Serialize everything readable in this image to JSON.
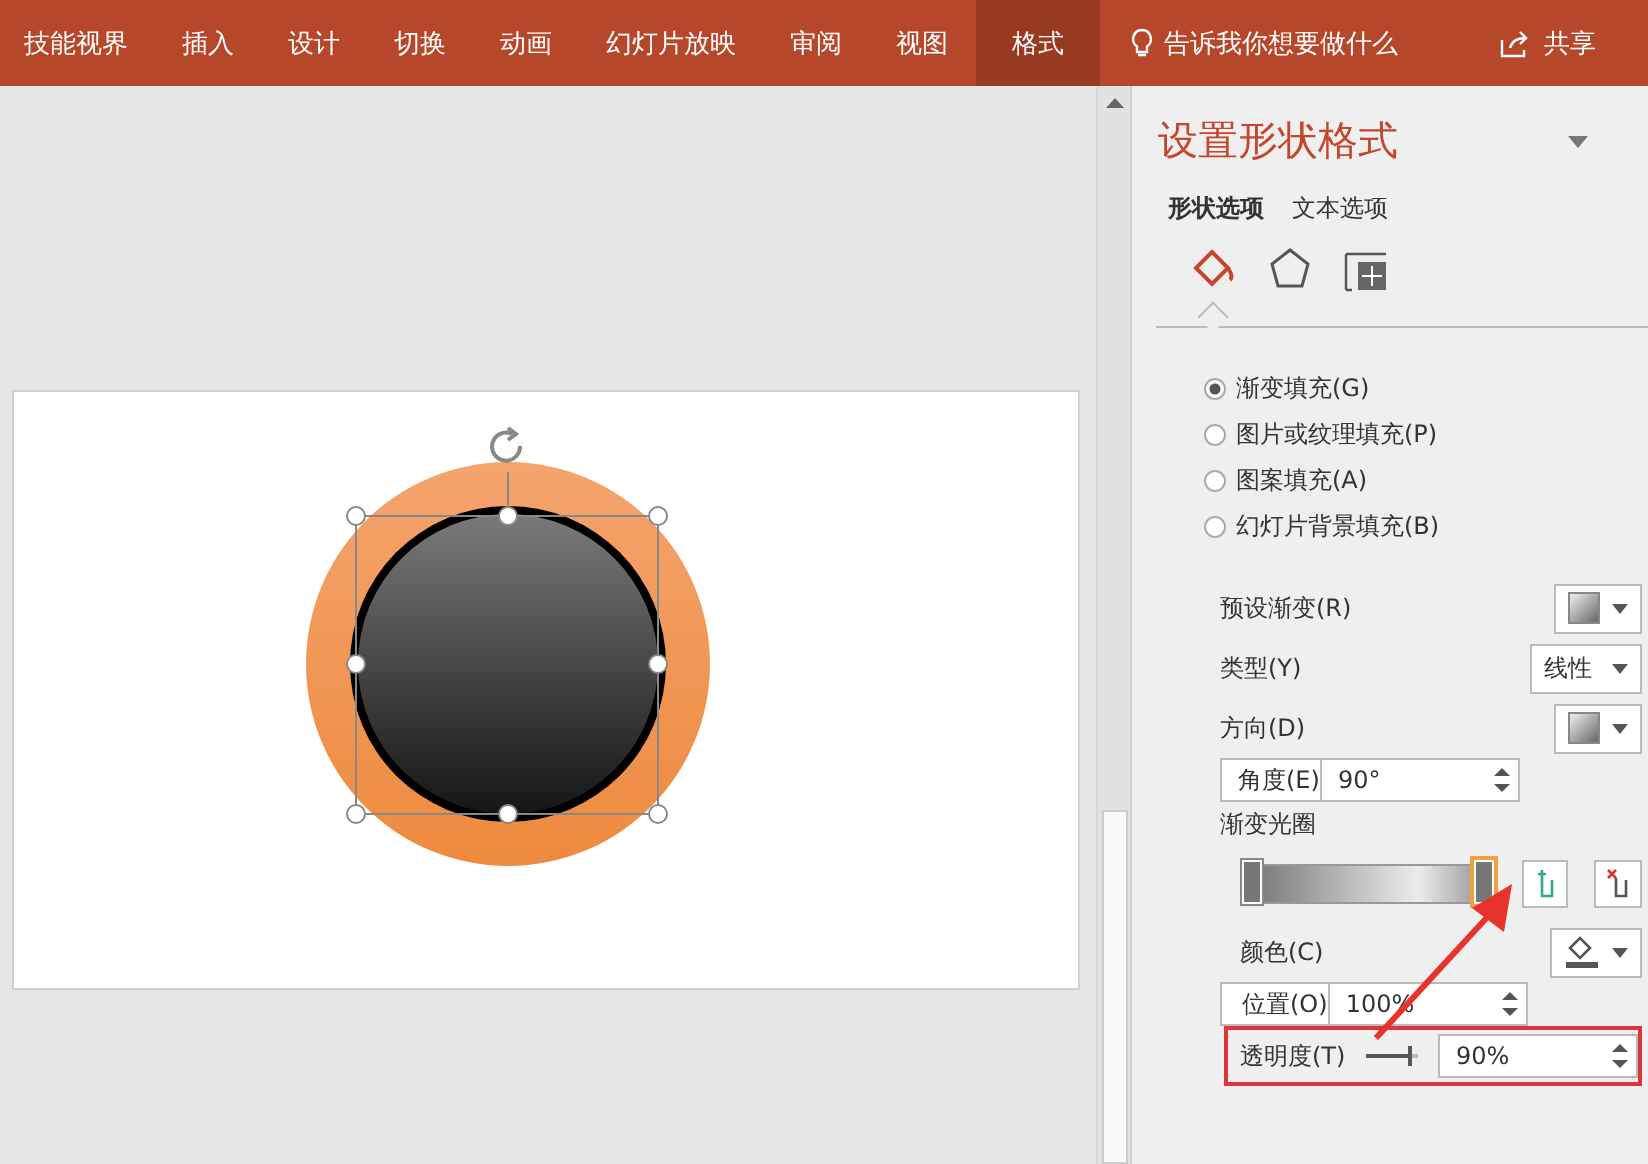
{
  "ribbon": {
    "tabs": [
      {
        "label": "技能视界",
        "selected": false
      },
      {
        "label": "插入",
        "selected": false
      },
      {
        "label": "设计",
        "selected": false
      },
      {
        "label": "切换",
        "selected": false
      },
      {
        "label": "动画",
        "selected": false
      },
      {
        "label": "幻灯片放映",
        "selected": false
      },
      {
        "label": "审阅",
        "selected": false
      },
      {
        "label": "视图",
        "selected": false
      },
      {
        "label": "格式",
        "selected": true
      }
    ],
    "tell_me": "告诉我你想要做什么",
    "share": "共享"
  },
  "panel": {
    "title": "设置形状格式",
    "option_tabs": [
      {
        "label": "形状选项",
        "selected": true
      },
      {
        "label": "文本选项",
        "selected": false
      }
    ],
    "icon_tabs": [
      {
        "kind": "fill",
        "selected": true
      },
      {
        "kind": "effects",
        "selected": false
      },
      {
        "kind": "size",
        "selected": false
      }
    ],
    "fill_options": [
      {
        "label": "渐变填充(G)",
        "selected": true
      },
      {
        "label": "图片或纹理填充(P)",
        "selected": false
      },
      {
        "label": "图案填充(A)",
        "selected": false
      },
      {
        "label": "幻灯片背景填充(B)",
        "selected": false
      }
    ],
    "rows": [
      {
        "kind": "swatch",
        "label": "预设渐变(R)"
      },
      {
        "kind": "select",
        "label": "类型(Y)",
        "value": "线性"
      },
      {
        "kind": "swatch",
        "label": "方向(D)"
      },
      {
        "kind": "spin",
        "label": "角度(E)",
        "value": "90°"
      },
      {
        "kind": "heading",
        "label": "渐变光圈"
      },
      {
        "kind": "stops",
        "stops": [
          {
            "level": 0,
            "selected": false
          },
          {
            "level": 1,
            "selected": true
          }
        ]
      },
      {
        "kind": "color",
        "label": "颜色(C)"
      },
      {
        "kind": "spin",
        "label": "位置(O)",
        "value": "100%"
      },
      {
        "kind": "slider",
        "label": "透明度(T)",
        "value": "90%",
        "level": 0.9,
        "highlighted": true
      }
    ]
  }
}
